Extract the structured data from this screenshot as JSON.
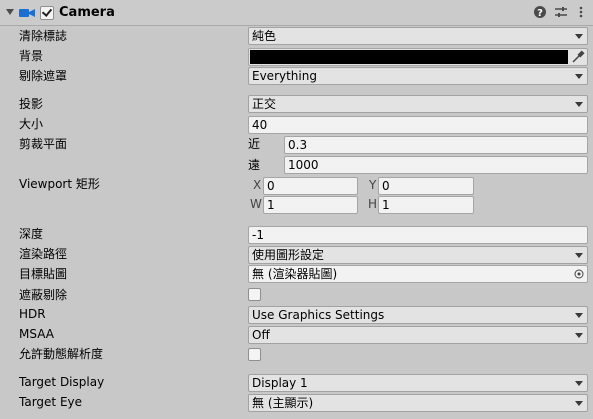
{
  "component": {
    "title": "Camera"
  },
  "labels": {
    "clear_flags": "清除標誌",
    "background": "背景",
    "culling_mask": "剔除遮罩",
    "projection": "投影",
    "size": "大小",
    "clipping_planes": "剪裁平面",
    "near": "近",
    "far": "遠",
    "viewport_rect": "Viewport 矩形",
    "x": "X",
    "y": "Y",
    "w": "W",
    "h": "H",
    "depth": "深度",
    "rendering_path": "渲染路徑",
    "target_texture": "目標貼圖",
    "occlusion_culling": "遮蔽剔除",
    "hdr": "HDR",
    "msaa": "MSAA",
    "allow_dynamic_resolution": "允許動態解析度",
    "target_display": "Target Display",
    "target_eye": "Target Eye"
  },
  "values": {
    "clear_flags": "純色",
    "background_color": "#000000",
    "culling_mask": "Everything",
    "projection": "正交",
    "size": "40",
    "near": "0.3",
    "far": "1000",
    "viewport_x": "0",
    "viewport_y": "0",
    "viewport_w": "1",
    "viewport_h": "1",
    "depth": "-1",
    "rendering_path": "使用圖形設定",
    "target_texture": "無 (渲染器貼圖)",
    "occlusion_culling": false,
    "hdr": "Use Graphics Settings",
    "msaa": "Off",
    "allow_dynamic_resolution": false,
    "target_display": "Display 1",
    "target_eye": "無 (主顯示)"
  },
  "icons": {
    "camera": "camera-icon",
    "help": "help-icon",
    "presets": "presets-icon",
    "menu": "kebab-menu-icon"
  },
  "colors": {
    "accent": "#1b6fd4",
    "panel": "#c8c8c8"
  }
}
